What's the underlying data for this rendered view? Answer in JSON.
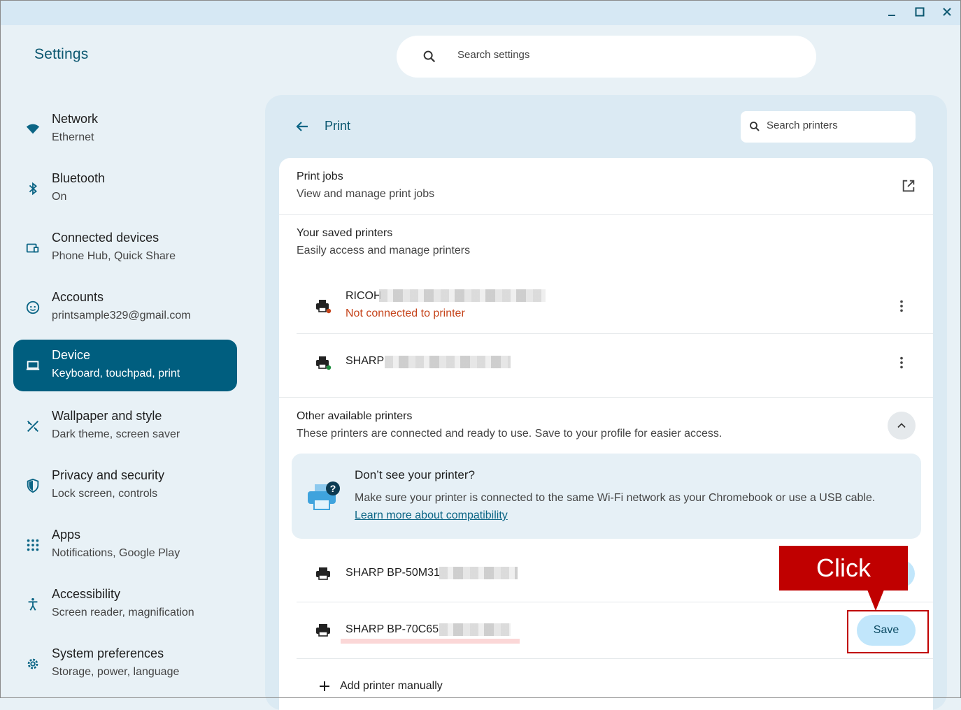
{
  "app": {
    "title": "Settings",
    "search_placeholder": "Search settings"
  },
  "window_controls": {
    "minimize": "minimize-icon",
    "maximize": "maximize-icon",
    "close": "close-icon"
  },
  "sidebar": {
    "items": [
      {
        "label": "Network",
        "sub": "Ethernet",
        "icon": "wifi-icon"
      },
      {
        "label": "Bluetooth",
        "sub": "On",
        "icon": "bluetooth-icon"
      },
      {
        "label": "Connected devices",
        "sub": "Phone Hub, Quick Share",
        "icon": "devices-icon"
      },
      {
        "label": "Accounts",
        "sub": "printsample329@gmail.com",
        "icon": "account-icon"
      },
      {
        "label": "Device",
        "sub": "Keyboard, touchpad, print",
        "icon": "laptop-icon",
        "active": true
      },
      {
        "label": "Wallpaper and style",
        "sub": "Dark theme, screen saver",
        "icon": "palette-icon"
      },
      {
        "label": "Privacy and security",
        "sub": "Lock screen, controls",
        "icon": "shield-icon"
      },
      {
        "label": "Apps",
        "sub": "Notifications, Google Play",
        "icon": "apps-grid-icon"
      },
      {
        "label": "Accessibility",
        "sub": "Screen reader, magnification",
        "icon": "accessibility-icon"
      },
      {
        "label": "System preferences",
        "sub": "Storage, power, language",
        "icon": "gear-icon"
      }
    ]
  },
  "print": {
    "title": "Print",
    "search_placeholder": "Search printers",
    "jobs": {
      "title": "Print jobs",
      "sub": "View and manage print jobs"
    },
    "saved": {
      "title": "Your saved printers",
      "sub": "Easily access and manage printers",
      "printers": [
        {
          "name": "RICOH",
          "status": "Not connected to printer",
          "status_color": "#c5431a"
        },
        {
          "name": "SHARP",
          "status": ""
        }
      ]
    },
    "other": {
      "title": "Other available printers",
      "sub": "These printers are connected and ready to use. Save to your profile for easier access.",
      "help": {
        "title": "Don’t see your printer?",
        "body": "Make sure your printer is connected to the same Wi-Fi network as your Chromebook or use a USB cable.",
        "link": "Learn more about compatibility"
      },
      "printers": [
        {
          "name": "SHARP BP-50M31"
        },
        {
          "name": "SHARP BP-70C65",
          "button": "Save"
        }
      ]
    },
    "add_manual": "Add printer manually"
  },
  "annotation": {
    "callout": "Click",
    "color": "#c00000"
  }
}
